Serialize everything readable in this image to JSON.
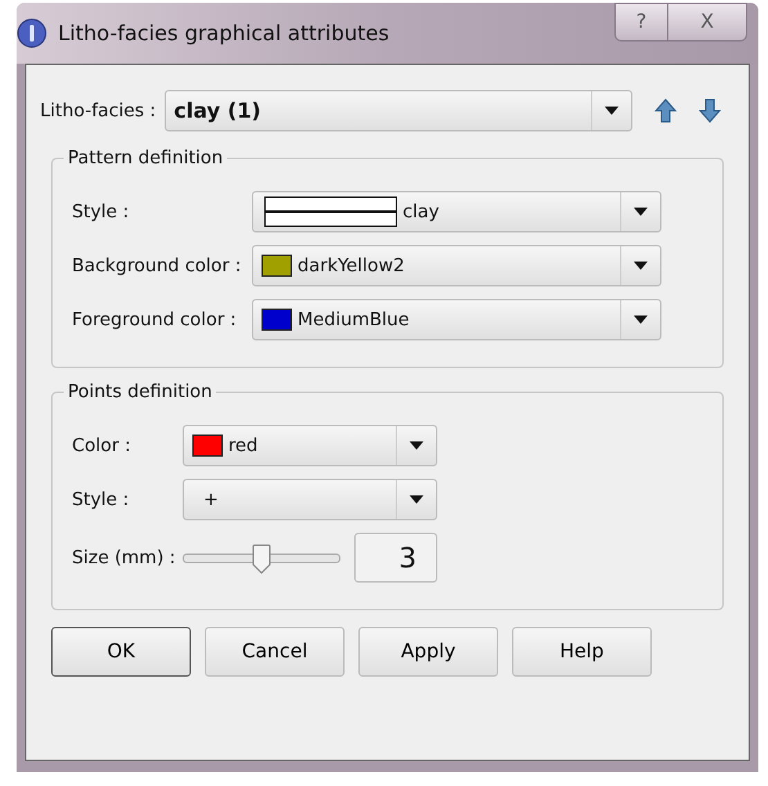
{
  "window": {
    "title": "Litho-facies graphical attributes",
    "help_button": "?",
    "close_button": "X"
  },
  "facies": {
    "label": "Litho-facies :",
    "value": "clay (1)"
  },
  "pattern": {
    "title": "Pattern definition",
    "rows": [
      {
        "label": "Style :",
        "kind": "pattern",
        "value": "clay"
      },
      {
        "label": "Background color :",
        "kind": "color",
        "color": "#a0a000",
        "value": "darkYellow2"
      },
      {
        "label": "Foreground color :",
        "kind": "color",
        "color": "#0000cd",
        "value": "MediumBlue"
      }
    ]
  },
  "points": {
    "title": "Points definition",
    "rows": [
      {
        "label": "Color :",
        "kind": "color",
        "color": "#ff0000",
        "value": "red"
      },
      {
        "label": "Style :",
        "kind": "text",
        "value": "+"
      }
    ],
    "size": {
      "label": "Size (mm) :",
      "level": 0.5,
      "value": "3"
    }
  },
  "buttons": [
    {
      "label": "OK",
      "selected": true
    },
    {
      "label": "Cancel",
      "selected": false
    },
    {
      "label": "Apply",
      "selected": false
    },
    {
      "label": "Help",
      "selected": false
    }
  ]
}
